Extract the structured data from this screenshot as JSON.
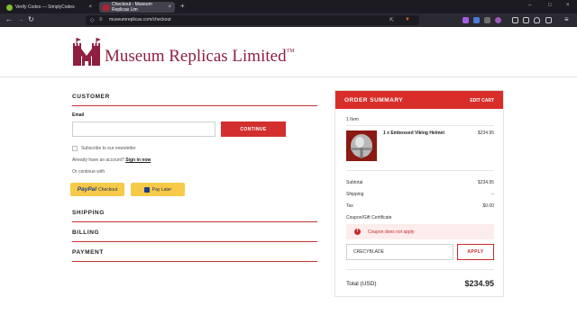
{
  "browser": {
    "tabs": [
      {
        "title": "Verify Codes — SimplyCodes",
        "close": "×"
      },
      {
        "title": "Checkout - Museum Replicas Lim",
        "close": "×"
      }
    ],
    "new_tab": "+",
    "window_controls": {
      "minimize": "–",
      "maximize": "□",
      "close": "×"
    },
    "nav": {
      "back": "←",
      "forward": "→",
      "reload": "↻"
    },
    "url": "museumreplicas.com/checkout"
  },
  "site": {
    "logo_title": "Museum Replicas Limited",
    "trademark": "TM",
    "brand_color": "#8e1f3f"
  },
  "checkout": {
    "customer": {
      "title": "CUSTOMER",
      "email_label": "Email",
      "email_value": "",
      "continue_label": "CONTINUE",
      "newsletter_label": "Subscribe to our newsletter",
      "account_prompt": "Already have an account?",
      "sign_in_label": "Sign in now",
      "or_continue": "Or continue with",
      "paypal_label": "PayPal",
      "paypal_checkout": "Checkout",
      "pay_later_label": "Pay Later"
    },
    "shipping_title": "SHIPPING",
    "billing_title": "BILLING",
    "payment_title": "PAYMENT",
    "accent_color": "#d92d2a"
  },
  "summary": {
    "title": "ORDER SUMMARY",
    "edit_label": "EDIT CART",
    "item_count": "1 Item",
    "item": {
      "name": "1 x Embossed Viking Helmet",
      "price": "$234.95"
    },
    "rows": [
      {
        "label": "Subtotal",
        "value": "$234.95"
      },
      {
        "label": "Shipping",
        "value": "--"
      },
      {
        "label": "Tax",
        "value": "$0.00"
      }
    ],
    "coupon_label": "Coupon/Gift Certificate",
    "alert_icon": "!",
    "alert_text": "Coupon does not apply",
    "coupon_value": "CRECYBLADE",
    "apply_label": "APPLY",
    "total_label": "Total (USD)",
    "total_value": "$234.95"
  }
}
